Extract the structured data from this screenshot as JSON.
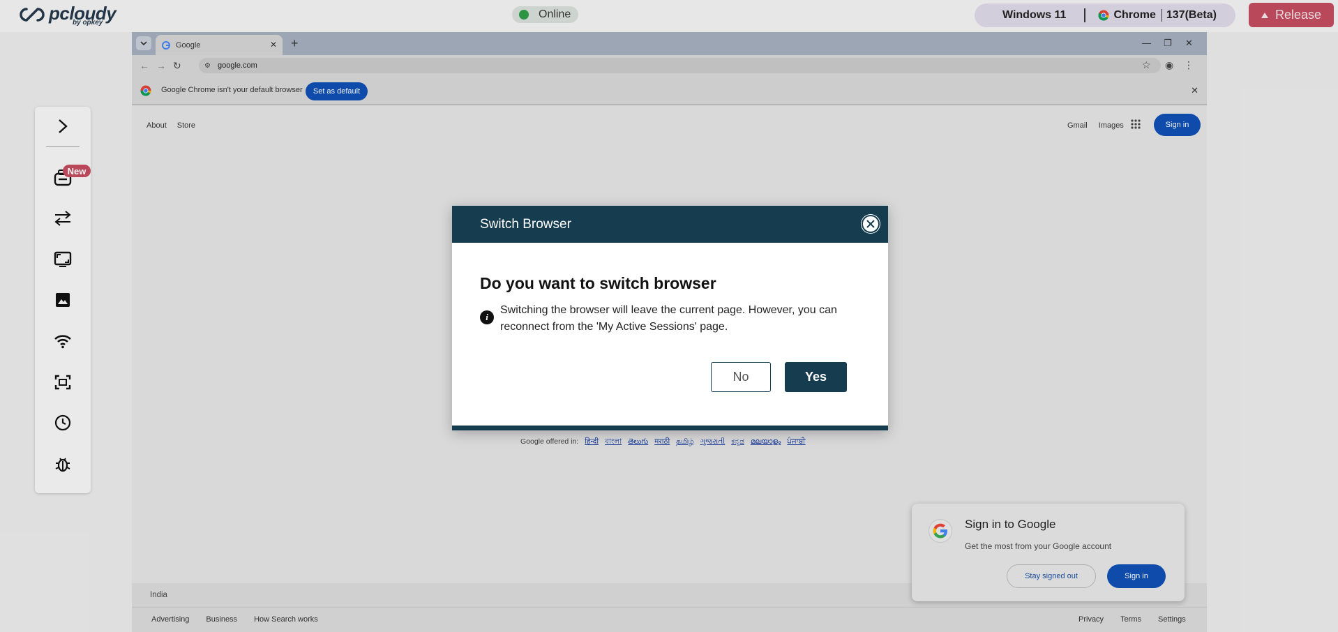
{
  "app": {
    "logo_text": "pcloudy",
    "logo_sub": "by opkey",
    "status": "Online",
    "os": "Windows 11",
    "browser": "Chrome",
    "version": "137(Beta)",
    "release_label": "Release"
  },
  "sidetools": {
    "new_badge": "New"
  },
  "browser": {
    "tab_title": "Google",
    "url": "google.com",
    "infobar_msg": "Google Chrome isn't your default browser",
    "set_default_label": "Set as default"
  },
  "google": {
    "links_left": [
      "About",
      "Store"
    ],
    "links_right": [
      "Gmail",
      "Images"
    ],
    "signin_label": "Sign in",
    "offered_in": "Google offered in:",
    "languages": [
      "हिन्दी",
      "বাংলা",
      "తెలుగు",
      "मराठी",
      "தமிழ்",
      "ગુજરાતી",
      "ಕನ್ನಡ",
      "മലയാളം",
      "ਪੰਜਾਬੀ"
    ],
    "country": "India",
    "footer_left": [
      "Advertising",
      "Business",
      "How Search works"
    ],
    "footer_right": [
      "Privacy",
      "Terms",
      "Settings"
    ]
  },
  "signin_popup": {
    "title": "Sign in to Google",
    "subtitle": "Get the most from your Google account",
    "stay_label": "Stay signed out",
    "signin_label": "Sign in"
  },
  "modal": {
    "title": "Switch Browser",
    "question": "Do you want to switch browser",
    "body": "Switching the browser will leave the current page. However, you can reconnect from the 'My Active Sessions' page.",
    "no_label": "No",
    "yes_label": "Yes"
  },
  "colors": {
    "primary": "#163c4f",
    "release": "#c24b5f",
    "google_blue": "#0f4fb2",
    "online_green": "#2f9a48"
  }
}
